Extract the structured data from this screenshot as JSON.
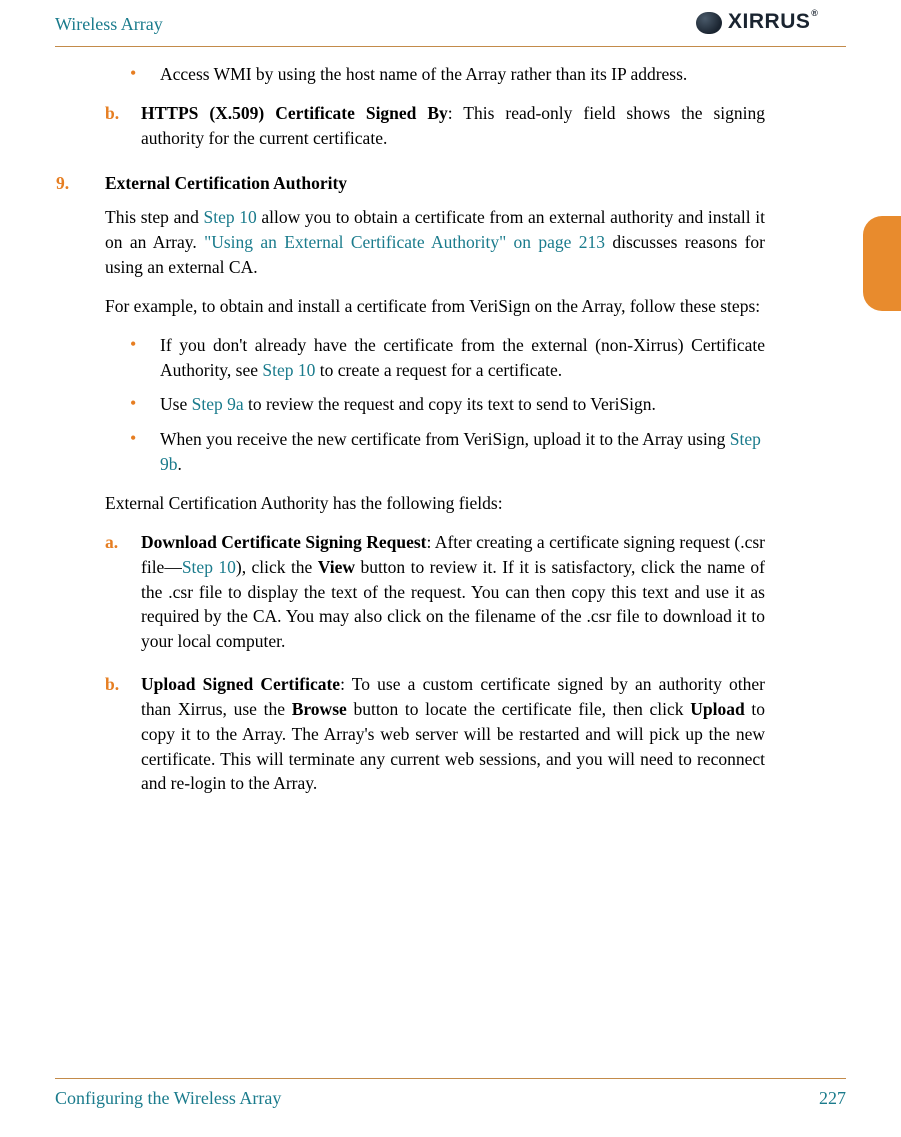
{
  "header": {
    "title": "Wireless Array",
    "brand": "XIRRUS"
  },
  "item1_bullet": "Access WMI by using the host name of the Array rather than its IP address.",
  "item1_b_letter": "b.",
  "item1_b_bold": "HTTPS (X.509) Certificate Signed By",
  "item1_b_rest": ": This read-only field shows the signing authority for the current certificate.",
  "section9_num": "9.",
  "section9_title": "External Certification Authority",
  "section9_p1_a": "This step and ",
  "section9_link1": "Step 10",
  "section9_p1_b": " allow you to obtain a certificate from an external authority and install it on an Array. ",
  "section9_link2": "\"Using an External Certificate Authority\" on page 213",
  "section9_p1_c": " discusses reasons for using an external CA.",
  "section9_p2": "For example, to obtain and install a certificate from VeriSign on the Array, follow these steps:",
  "bl1_a": "If you don't already have the certificate from the external (non-Xirrus) Certificate Authority, see ",
  "bl1_link": "Step 10",
  "bl1_b": " to create a request for a certificate.",
  "bl2_a": "Use ",
  "bl2_link": "Step 9a",
  "bl2_b": " to review the request and copy its text to send to VeriSign.",
  "bl3_a": "When you receive the new certificate from VeriSign, upload it to the Array using ",
  "bl3_link": "Step 9b",
  "bl3_b": ".",
  "section9_p3": "External Certification Authority has the following fields:",
  "la_letter": "a.",
  "la_bold": "Download Certificate Signing Request",
  "la_a": ": After creating a certificate signing request (.csr file—",
  "la_link": "Step 10",
  "la_b": "), click the ",
  "la_bold2": "View",
  "la_c": " button to review it. If it is satisfactory, click the name of the .csr file to display the text of the request. You can then copy this text and use it as required by the CA. You may also click on the filename of the .csr file to download it to your local computer.",
  "lb_letter": "b.",
  "lb_bold": "Upload Signed Certificate",
  "lb_a": ": To use a custom certificate signed by an authority other than Xirrus, use the ",
  "lb_bold2": "Browse",
  "lb_b": " button to locate the certificate file, then click ",
  "lb_bold3": "Upload",
  "lb_c": " to copy it to the Array. The Array's web server will be restarted and will pick up the new certificate. This will terminate any current web sessions, and you will need to reconnect and re-login to the Array.",
  "footer": {
    "left": "Configuring the Wireless Array",
    "page": "227"
  }
}
